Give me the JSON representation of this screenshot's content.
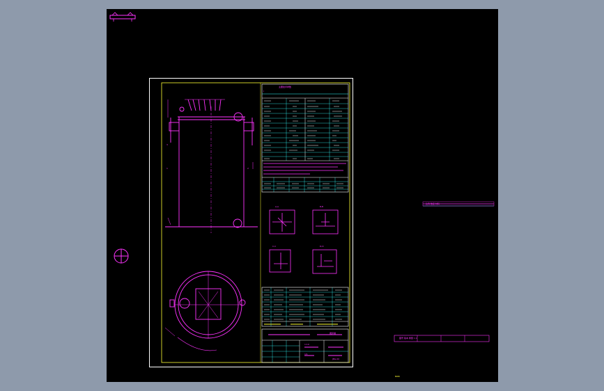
{
  "drawing": {
    "tech_title": "主要技术参数",
    "tech_sub": "Ⅰ",
    "note_lines": [
      "技术要求",
      "1.",
      "2.",
      "3."
    ],
    "section_labels": [
      "A-A",
      "B-B",
      "C-C",
      "D-D"
    ],
    "title_block": {
      "company": "搅拌罐",
      "drawing_no": "JBG-00",
      "scale": "1:10",
      "sheet": "1/1"
    }
  },
  "sidebar": {
    "table_a": "比例   数量   材料",
    "table_b": "图号   版本   重量   1:1"
  },
  "status": {
    "coord": "NNN"
  },
  "colors": {
    "background": "#8e9aab",
    "canvas": "#000000",
    "magenta": "#ff33ff",
    "cyan": "#33ffff",
    "yellow": "#ffff33",
    "white": "#ffffff"
  }
}
